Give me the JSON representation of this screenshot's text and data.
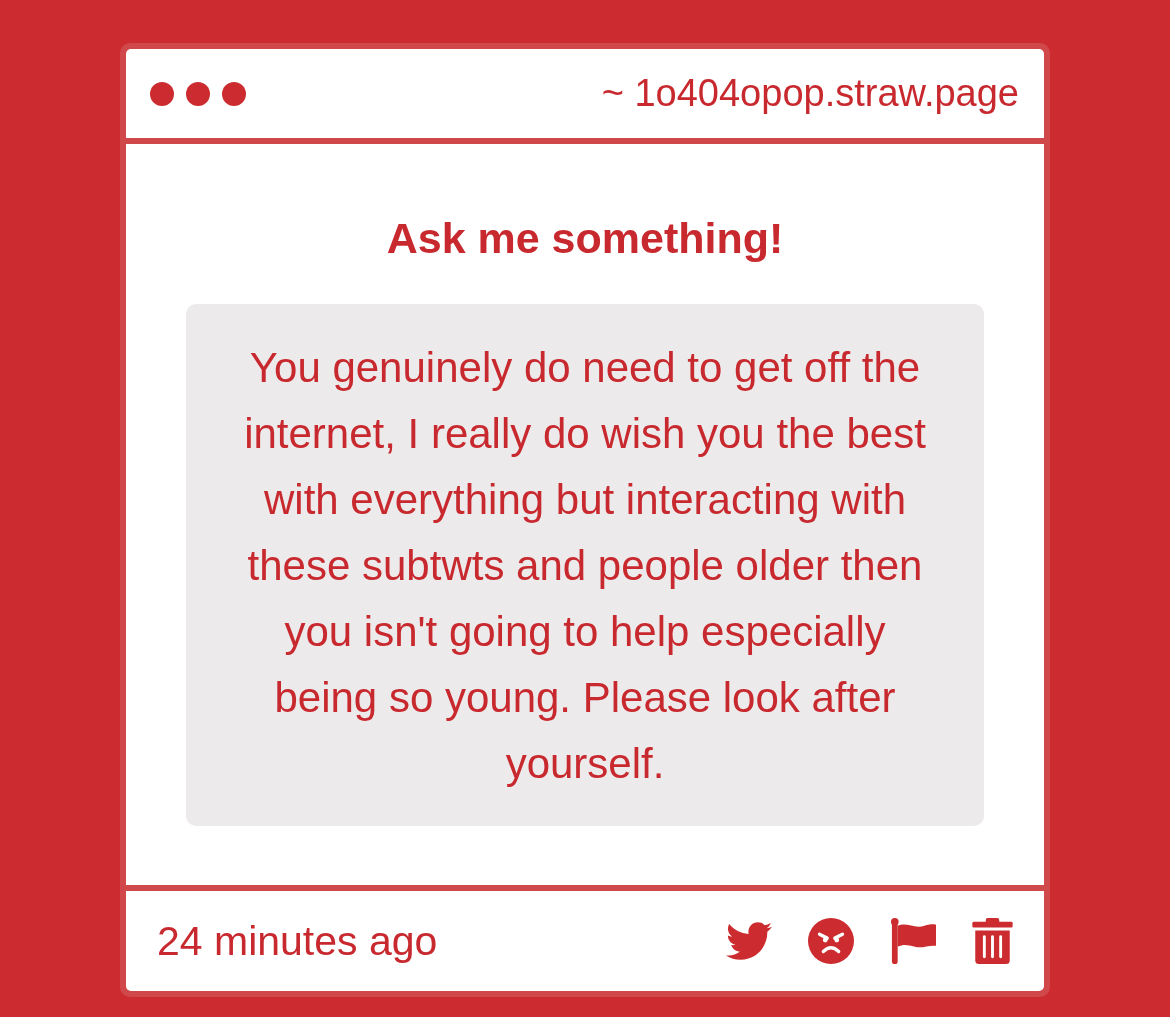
{
  "header": {
    "url": "~ 1o404opop.straw.page"
  },
  "question": {
    "title": "Ask me something!",
    "message": "You genuinely do need to get off the internet, I really do wish you the best with everything but interacting with these subtwts and people older then you isn't going to help especially being so young. Please look after yourself."
  },
  "footer": {
    "time": "24 minutes ago"
  }
}
